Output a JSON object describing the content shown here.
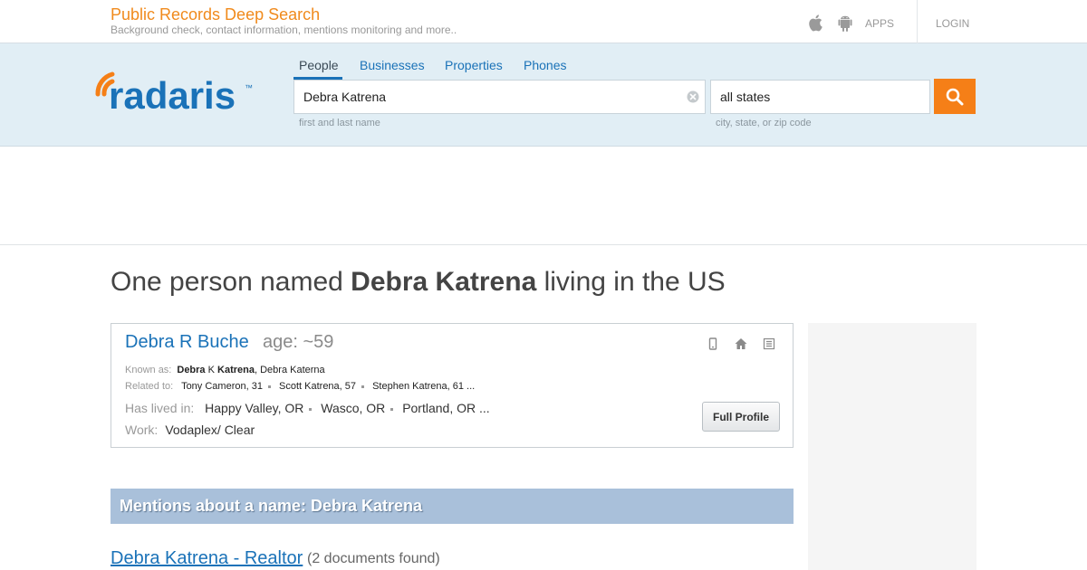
{
  "topbar": {
    "title": "Public Records Deep Search",
    "subtitle": "Background check, contact information, mentions monitoring and more..",
    "apps_label": "APPS",
    "login_label": "LOGIN"
  },
  "logo": {
    "text": "radaris",
    "trademark": "™"
  },
  "search": {
    "tabs": [
      {
        "label": "People",
        "active": true
      },
      {
        "label": "Businesses",
        "active": false
      },
      {
        "label": "Properties",
        "active": false
      },
      {
        "label": "Phones",
        "active": false
      }
    ],
    "name_value": "Debra Katrena",
    "name_hint": "first and last name",
    "location_value": "all states",
    "location_hint": "city, state, or zip code"
  },
  "heading": {
    "prefix": "One person named ",
    "name": "Debra Katrena",
    "suffix": " living in the US"
  },
  "result": {
    "name": "Debra R Buche",
    "age": "age: ~59",
    "known_as_label": "Known as:",
    "known_as": {
      "b1": "Debra",
      "mid": " K ",
      "b2": "Katrena",
      "rest": ", Debra Katerna"
    },
    "related_label": "Related to:",
    "related": [
      "Tony Cameron, 31",
      "Scott Katrena, 57",
      "Stephen Katrena, 61 ..."
    ],
    "lived_label": "Has lived in:",
    "lived": [
      "Happy Valley, OR",
      "Wasco, OR",
      "Portland, OR ..."
    ],
    "work_label": "Work:",
    "work": "Vodaplex/ Clear",
    "full_profile_label": "Full Profile",
    "icons": [
      "phone-icon",
      "home-icon",
      "document-icon"
    ]
  },
  "mentions": {
    "header": "Mentions about a name: Debra Katrena",
    "link_text": "Debra Katrena - Realtor",
    "link_count": "(2 documents found)"
  },
  "colors": {
    "accent_orange": "#f57f17",
    "title_orange": "#f08a1c",
    "link_blue": "#1a72b8",
    "band_bg": "#e1eef5",
    "mentions_bg": "#a9c0da"
  }
}
